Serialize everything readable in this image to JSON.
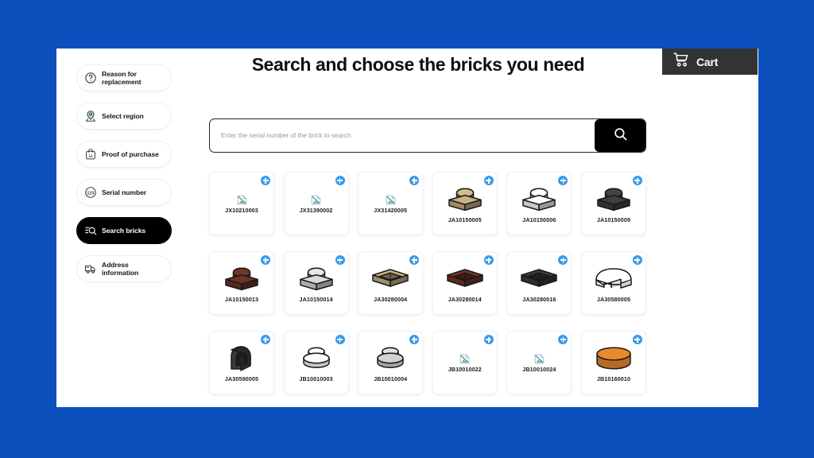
{
  "theme": {
    "background_blue": "#0b50bd",
    "panel_white": "#ffffff",
    "accent_black": "#000000",
    "badge_blue": "#3b9bea",
    "cart_gray": "#333333"
  },
  "header": {
    "title": "Search and choose the bricks you need",
    "cart": {
      "label": "Cart",
      "icon": "shopping-cart-icon"
    }
  },
  "search": {
    "placeholder": "Enter the serial number of the brick to search",
    "value": "",
    "submit_icon": "search-icon"
  },
  "sidebar": {
    "items": [
      {
        "label": "Reason for replacement",
        "icon": "question-circle-icon",
        "active": false
      },
      {
        "label": "Select region",
        "icon": "map-pin-icon",
        "active": false
      },
      {
        "label": "Proof of purchase",
        "icon": "receipt-bag-icon",
        "active": false
      },
      {
        "label": "Serial number",
        "icon": "numbers-123-circle-icon",
        "active": false
      },
      {
        "label": "Search bricks",
        "icon": "search-list-icon",
        "active": true
      },
      {
        "label": "Address information",
        "icon": "delivery-truck-icon",
        "active": false
      }
    ]
  },
  "grid": {
    "add_badge_label": "+",
    "bricks": [
      {
        "code": "JX10210003",
        "art": "broken-image",
        "color": ""
      },
      {
        "code": "JX31390002",
        "art": "broken-image",
        "color": ""
      },
      {
        "code": "JX31420005",
        "art": "broken-image",
        "color": ""
      },
      {
        "code": "JA10150005",
        "art": "plate-1x1-stud",
        "color": "#c9b183"
      },
      {
        "code": "JA10150006",
        "art": "plate-1x1-stud",
        "color": "#ffffff"
      },
      {
        "code": "JA10150009",
        "art": "plate-1x1-stud",
        "color": "#3f3f3f"
      },
      {
        "code": "JA10150013",
        "art": "plate-1x1-stud",
        "color": "#6e3325"
      },
      {
        "code": "JA10150014",
        "art": "plate-1x1-stud",
        "color": "#dcdcdc"
      },
      {
        "code": "JA30280004",
        "art": "open-frame-brick",
        "color": "#ccb485"
      },
      {
        "code": "JA30280014",
        "art": "open-frame-brick",
        "color": "#7b3327"
      },
      {
        "code": "JA30280016",
        "art": "open-frame-brick",
        "color": "#3b3b3b"
      },
      {
        "code": "JA30580005",
        "art": "corner-slope-brick",
        "color": "#ffffff"
      },
      {
        "code": "JA30590005",
        "art": "arch-brick",
        "color": "#3a3a3a"
      },
      {
        "code": "JB10010003",
        "art": "round-stud-plate",
        "color": "#ffffff"
      },
      {
        "code": "JB10010004",
        "art": "round-stud-plate",
        "color": "#d5d5d5"
      },
      {
        "code": "JB10010022",
        "art": "broken-image",
        "color": ""
      },
      {
        "code": "JB10010024",
        "art": "broken-image",
        "color": ""
      },
      {
        "code": "JB10160010",
        "art": "round-cylinder",
        "color": "#e8892e"
      }
    ]
  }
}
